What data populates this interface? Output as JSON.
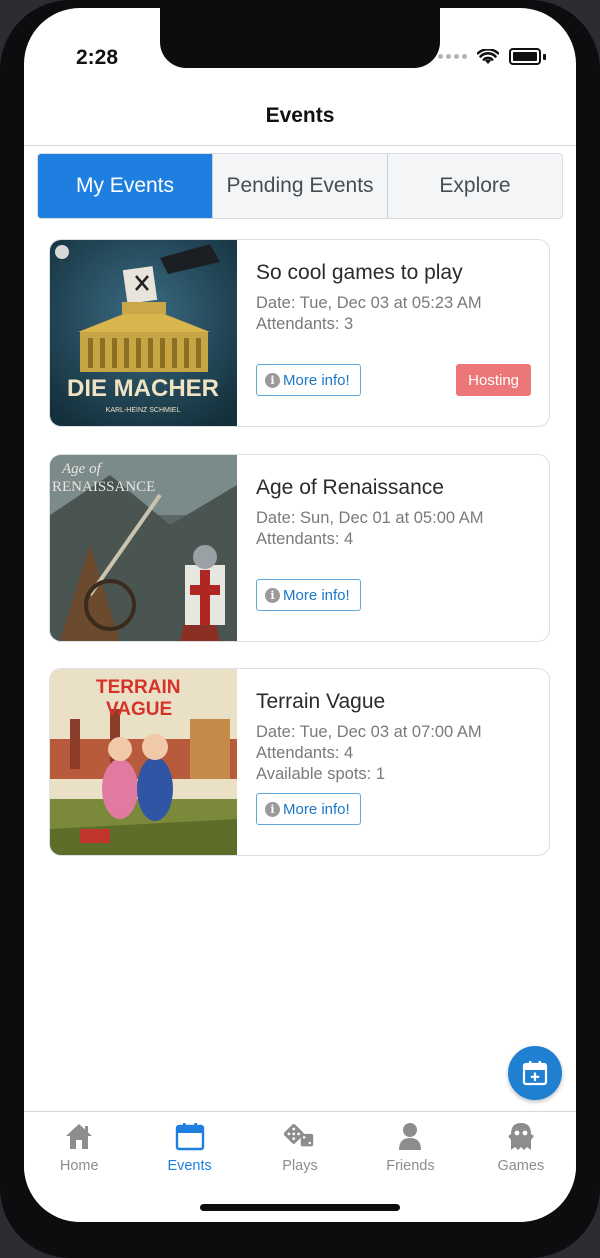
{
  "status_bar": {
    "time": "2:28"
  },
  "header": {
    "title": "Events"
  },
  "segments": [
    {
      "label": "My Events",
      "active": true
    },
    {
      "label": "Pending Events",
      "active": false
    },
    {
      "label": "Explore",
      "active": false
    }
  ],
  "events": [
    {
      "title": "So cool games to play",
      "date": "Date: Tue, Dec 03 at 05:23 AM",
      "attendants": "Attendants: 3",
      "more_label": "More info!",
      "badge": "Hosting",
      "image_text": "DIE MACHER",
      "image_subtext": "KARL-HEINZ SCHMIEL"
    },
    {
      "title": "Age of Renaissance",
      "date": "Date: Sun, Dec 01 at 05:00 AM",
      "attendants": "Attendants: 4",
      "more_label": "More info!",
      "image_text": "Age of",
      "image_subtext": "RENAISSANCE"
    },
    {
      "title": "Terrain Vague",
      "date": "Date: Tue, Dec 03 at 07:00 AM",
      "attendants": "Attendants: 4",
      "spots": "Available spots: 1",
      "more_label": "More info!",
      "image_text": "TERRAIN",
      "image_subtext": "VAGUE"
    }
  ],
  "tabs": [
    {
      "label": "Home",
      "icon": "home-icon",
      "active": false
    },
    {
      "label": "Events",
      "icon": "calendar-icon",
      "active": true
    },
    {
      "label": "Plays",
      "icon": "dice-icon",
      "active": false
    },
    {
      "label": "Friends",
      "icon": "person-icon",
      "active": false
    },
    {
      "label": "Games",
      "icon": "ghost-icon",
      "active": false
    }
  ],
  "colors": {
    "accent": "#1e7fe0",
    "hosting_badge": "#ec7778",
    "fab": "#1f80d1"
  }
}
